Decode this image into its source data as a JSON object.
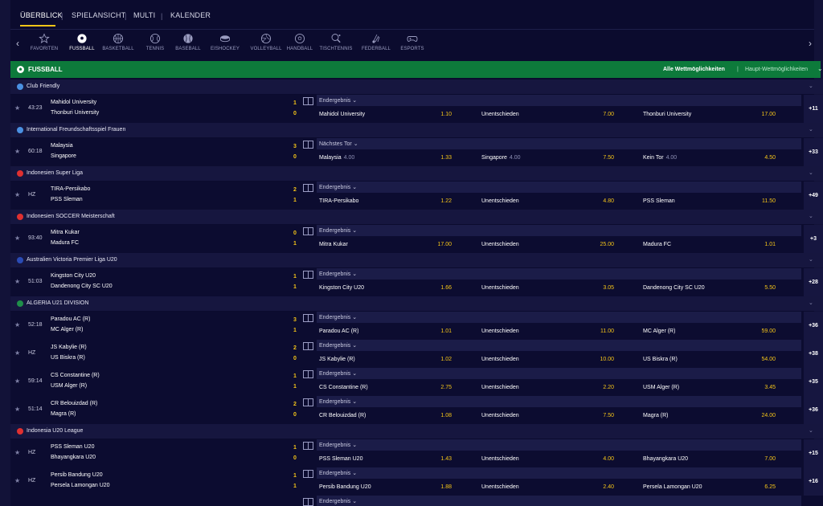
{
  "nav": {
    "tabs": [
      {
        "label": "ÜBERBLICK",
        "active": true
      },
      {
        "label": "SPIELANSICHT",
        "active": false
      },
      {
        "label": "MULTI",
        "active": false
      },
      {
        "label": "KALENDER",
        "active": false
      }
    ]
  },
  "sports": [
    {
      "label": "FAVORITEN",
      "icon": "star-icon"
    },
    {
      "label": "FUSSBALL",
      "icon": "soccer-ball-icon",
      "active": true
    },
    {
      "label": "BASKETBALL",
      "icon": "basketball-icon"
    },
    {
      "label": "TENNIS",
      "icon": "tennis-ball-icon"
    },
    {
      "label": "BASEBALL",
      "icon": "baseball-icon"
    },
    {
      "label": "EISHOCKEY",
      "icon": "hockey-puck-icon"
    },
    {
      "label": "VOLLEYBALL",
      "icon": "volleyball-icon"
    },
    {
      "label": "HANDBALL",
      "icon": "handball-icon"
    },
    {
      "label": "TISCHTENNIS",
      "icon": "table-tennis-icon"
    },
    {
      "label": "FEDERBALL",
      "icon": "shuttlecock-icon"
    },
    {
      "label": "ESPORTS",
      "icon": "gamepad-icon"
    }
  ],
  "section": {
    "title": "FUSSBALL",
    "all_markets": "Alle Wettmöglichkeiten",
    "main_markets": "Haupt-Wettmöglichkeiten"
  },
  "leagues": [
    {
      "name": "Club Friendly",
      "flag": "#4a90e2",
      "matches": [
        {
          "time": "43:23",
          "team1": "Mahidol University",
          "team2": "Thonburi University",
          "score1": "1",
          "score2": "0",
          "market": "Endergebnis",
          "selections": [
            {
              "label": "Mahidol University",
              "odd": "1.10"
            },
            {
              "label": "Unentschieden",
              "odd": "7.00"
            },
            {
              "label": "Thonburi University",
              "odd": "17.00"
            }
          ],
          "more": "+11"
        }
      ]
    },
    {
      "name": "International Freundschaftsspiel Frauen",
      "flag": "#4a90e2",
      "matches": [
        {
          "time": "60:18",
          "team1": "Malaysia",
          "team2": "Singapore",
          "score1": "3",
          "score2": "0",
          "market": "Nächstes Tor",
          "selections": [
            {
              "label": "Malaysia",
              "handicap": "4.00",
              "odd": "1.33"
            },
            {
              "label": "Singapore",
              "handicap": "4.00",
              "odd": "7.50"
            },
            {
              "label": "Kein Tor",
              "handicap": "4.00",
              "odd": "4.50"
            }
          ],
          "more": "+33"
        }
      ]
    },
    {
      "name": "Indonesien Super Liga",
      "flag": "#e03030",
      "matches": [
        {
          "time": "HZ",
          "team1": "TIRA-Persikabo",
          "team2": "PSS Sleman",
          "score1": "2",
          "score2": "1",
          "market": "Endergebnis",
          "selections": [
            {
              "label": "TIRA-Persikabo",
              "odd": "1.22"
            },
            {
              "label": "Unentschieden",
              "odd": "4.80"
            },
            {
              "label": "PSS Sleman",
              "odd": "11.50"
            }
          ],
          "more": "+49"
        }
      ]
    },
    {
      "name": "Indonesien SOCCER Meisterschaft",
      "flag": "#e03030",
      "matches": [
        {
          "time": "93:40",
          "team1": "Mitra Kukar",
          "team2": "Madura FC",
          "score1": "0",
          "score2": "1",
          "market": "Endergebnis",
          "selections": [
            {
              "label": "Mitra Kukar",
              "odd": "17.00"
            },
            {
              "label": "Unentschieden",
              "odd": "25.00"
            },
            {
              "label": "Madura FC",
              "odd": "1.01"
            }
          ],
          "more": "+3"
        }
      ]
    },
    {
      "name": "Australien Victoria Premier Liga U20",
      "flag": "#2a4bb5",
      "matches": [
        {
          "time": "51:03",
          "team1": "Kingston City U20",
          "team2": "Dandenong City SC U20",
          "score1": "1",
          "score2": "1",
          "market": "Endergebnis",
          "selections": [
            {
              "label": "Kingston City U20",
              "odd": "1.66"
            },
            {
              "label": "Unentschieden",
              "odd": "3.05"
            },
            {
              "label": "Dandenong City SC U20",
              "odd": "5.50"
            }
          ],
          "more": "+28"
        }
      ]
    },
    {
      "name": "ALGERIA U21 DIVISION",
      "flag": "#1f8f4a",
      "matches": [
        {
          "time": "52:18",
          "team1": "Paradou AC (R)",
          "team2": "MC Alger (R)",
          "score1": "3",
          "score2": "1",
          "market": "Endergebnis",
          "selections": [
            {
              "label": "Paradou AC (R)",
              "odd": "1.01"
            },
            {
              "label": "Unentschieden",
              "odd": "11.00"
            },
            {
              "label": "MC Alger (R)",
              "odd": "59.00"
            }
          ],
          "more": "+36"
        },
        {
          "time": "HZ",
          "team1": "JS Kabylie (R)",
          "team2": "US Biskra (R)",
          "score1": "2",
          "score2": "0",
          "market": "Endergebnis",
          "selections": [
            {
              "label": "JS Kabylie (R)",
              "odd": "1.02"
            },
            {
              "label": "Unentschieden",
              "odd": "10.00"
            },
            {
              "label": "US Biskra (R)",
              "odd": "54.00"
            }
          ],
          "more": "+38"
        },
        {
          "time": "59:14",
          "team1": "CS Constantine (R)",
          "team2": "USM Alger (R)",
          "score1": "1",
          "score2": "1",
          "market": "Endergebnis",
          "selections": [
            {
              "label": "CS Constantine (R)",
              "odd": "2.75"
            },
            {
              "label": "Unentschieden",
              "odd": "2.20"
            },
            {
              "label": "USM Alger (R)",
              "odd": "3.45"
            }
          ],
          "more": "+35"
        },
        {
          "time": "51:14",
          "team1": "CR Belouizdad (R)",
          "team2": "Magra (R)",
          "score1": "2",
          "score2": "0",
          "market": "Endergebnis",
          "selections": [
            {
              "label": "CR Belouizdad (R)",
              "odd": "1.08"
            },
            {
              "label": "Unentschieden",
              "odd": "7.50"
            },
            {
              "label": "Magra (R)",
              "odd": "24.00"
            }
          ],
          "more": "+36"
        }
      ]
    },
    {
      "name": "Indonesia U20 League",
      "flag": "#e03030",
      "matches": [
        {
          "time": "HZ",
          "team1": "PSS Sleman U20",
          "team2": "Bhayangkara U20",
          "score1": "1",
          "score2": "0",
          "market": "Endergebnis",
          "selections": [
            {
              "label": "PSS Sleman U20",
              "odd": "1.43"
            },
            {
              "label": "Unentschieden",
              "odd": "4.00"
            },
            {
              "label": "Bhayangkara U20",
              "odd": "7.00"
            }
          ],
          "more": "+15"
        },
        {
          "time": "HZ",
          "team1": "Persib Bandung U20",
          "team2": "Persela Lamongan U20",
          "score1": "1",
          "score2": "1",
          "market": "Endergebnis",
          "selections": [
            {
              "label": "Persib Bandung U20",
              "odd": "1.88"
            },
            {
              "label": "Unentschieden",
              "odd": "2.40"
            },
            {
              "label": "Persela Lamongan U20",
              "odd": "6.25"
            }
          ],
          "more": "+16"
        },
        {
          "time": "",
          "team1": "",
          "team2": "",
          "score1": "",
          "score2": "",
          "market": "Endergebnis",
          "selections": [],
          "more": ""
        }
      ]
    }
  ]
}
